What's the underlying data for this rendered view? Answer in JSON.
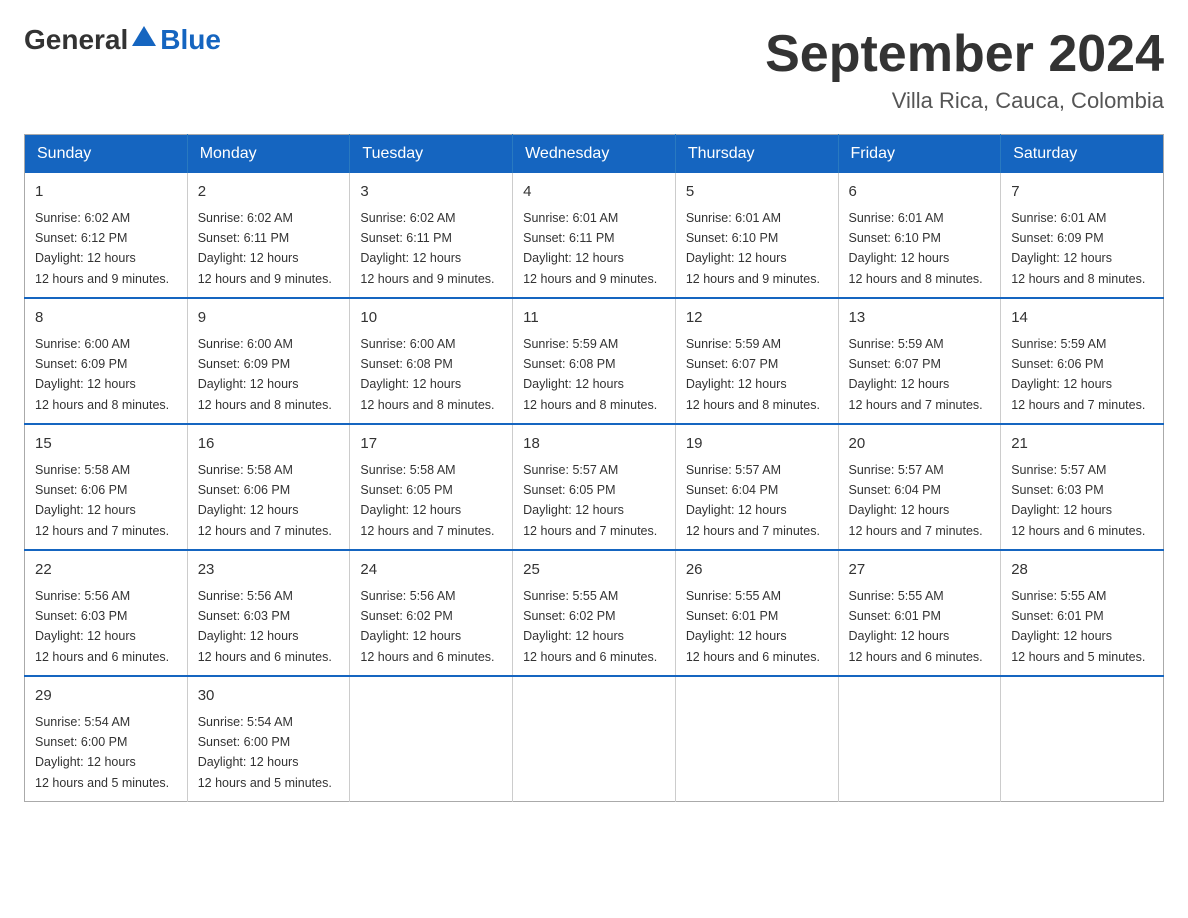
{
  "logo": {
    "general": "General",
    "blue": "Blue"
  },
  "title": "September 2024",
  "subtitle": "Villa Rica, Cauca, Colombia",
  "headers": [
    "Sunday",
    "Monday",
    "Tuesday",
    "Wednesday",
    "Thursday",
    "Friday",
    "Saturday"
  ],
  "weeks": [
    [
      {
        "day": "1",
        "sunrise": "6:02 AM",
        "sunset": "6:12 PM",
        "daylight": "12 hours and 9 minutes."
      },
      {
        "day": "2",
        "sunrise": "6:02 AM",
        "sunset": "6:11 PM",
        "daylight": "12 hours and 9 minutes."
      },
      {
        "day": "3",
        "sunrise": "6:02 AM",
        "sunset": "6:11 PM",
        "daylight": "12 hours and 9 minutes."
      },
      {
        "day": "4",
        "sunrise": "6:01 AM",
        "sunset": "6:11 PM",
        "daylight": "12 hours and 9 minutes."
      },
      {
        "day": "5",
        "sunrise": "6:01 AM",
        "sunset": "6:10 PM",
        "daylight": "12 hours and 9 minutes."
      },
      {
        "day": "6",
        "sunrise": "6:01 AM",
        "sunset": "6:10 PM",
        "daylight": "12 hours and 8 minutes."
      },
      {
        "day": "7",
        "sunrise": "6:01 AM",
        "sunset": "6:09 PM",
        "daylight": "12 hours and 8 minutes."
      }
    ],
    [
      {
        "day": "8",
        "sunrise": "6:00 AM",
        "sunset": "6:09 PM",
        "daylight": "12 hours and 8 minutes."
      },
      {
        "day": "9",
        "sunrise": "6:00 AM",
        "sunset": "6:09 PM",
        "daylight": "12 hours and 8 minutes."
      },
      {
        "day": "10",
        "sunrise": "6:00 AM",
        "sunset": "6:08 PM",
        "daylight": "12 hours and 8 minutes."
      },
      {
        "day": "11",
        "sunrise": "5:59 AM",
        "sunset": "6:08 PM",
        "daylight": "12 hours and 8 minutes."
      },
      {
        "day": "12",
        "sunrise": "5:59 AM",
        "sunset": "6:07 PM",
        "daylight": "12 hours and 8 minutes."
      },
      {
        "day": "13",
        "sunrise": "5:59 AM",
        "sunset": "6:07 PM",
        "daylight": "12 hours and 7 minutes."
      },
      {
        "day": "14",
        "sunrise": "5:59 AM",
        "sunset": "6:06 PM",
        "daylight": "12 hours and 7 minutes."
      }
    ],
    [
      {
        "day": "15",
        "sunrise": "5:58 AM",
        "sunset": "6:06 PM",
        "daylight": "12 hours and 7 minutes."
      },
      {
        "day": "16",
        "sunrise": "5:58 AM",
        "sunset": "6:06 PM",
        "daylight": "12 hours and 7 minutes."
      },
      {
        "day": "17",
        "sunrise": "5:58 AM",
        "sunset": "6:05 PM",
        "daylight": "12 hours and 7 minutes."
      },
      {
        "day": "18",
        "sunrise": "5:57 AM",
        "sunset": "6:05 PM",
        "daylight": "12 hours and 7 minutes."
      },
      {
        "day": "19",
        "sunrise": "5:57 AM",
        "sunset": "6:04 PM",
        "daylight": "12 hours and 7 minutes."
      },
      {
        "day": "20",
        "sunrise": "5:57 AM",
        "sunset": "6:04 PM",
        "daylight": "12 hours and 7 minutes."
      },
      {
        "day": "21",
        "sunrise": "5:57 AM",
        "sunset": "6:03 PM",
        "daylight": "12 hours and 6 minutes."
      }
    ],
    [
      {
        "day": "22",
        "sunrise": "5:56 AM",
        "sunset": "6:03 PM",
        "daylight": "12 hours and 6 minutes."
      },
      {
        "day": "23",
        "sunrise": "5:56 AM",
        "sunset": "6:03 PM",
        "daylight": "12 hours and 6 minutes."
      },
      {
        "day": "24",
        "sunrise": "5:56 AM",
        "sunset": "6:02 PM",
        "daylight": "12 hours and 6 minutes."
      },
      {
        "day": "25",
        "sunrise": "5:55 AM",
        "sunset": "6:02 PM",
        "daylight": "12 hours and 6 minutes."
      },
      {
        "day": "26",
        "sunrise": "5:55 AM",
        "sunset": "6:01 PM",
        "daylight": "12 hours and 6 minutes."
      },
      {
        "day": "27",
        "sunrise": "5:55 AM",
        "sunset": "6:01 PM",
        "daylight": "12 hours and 6 minutes."
      },
      {
        "day": "28",
        "sunrise": "5:55 AM",
        "sunset": "6:01 PM",
        "daylight": "12 hours and 5 minutes."
      }
    ],
    [
      {
        "day": "29",
        "sunrise": "5:54 AM",
        "sunset": "6:00 PM",
        "daylight": "12 hours and 5 minutes."
      },
      {
        "day": "30",
        "sunrise": "5:54 AM",
        "sunset": "6:00 PM",
        "daylight": "12 hours and 5 minutes."
      },
      null,
      null,
      null,
      null,
      null
    ]
  ]
}
